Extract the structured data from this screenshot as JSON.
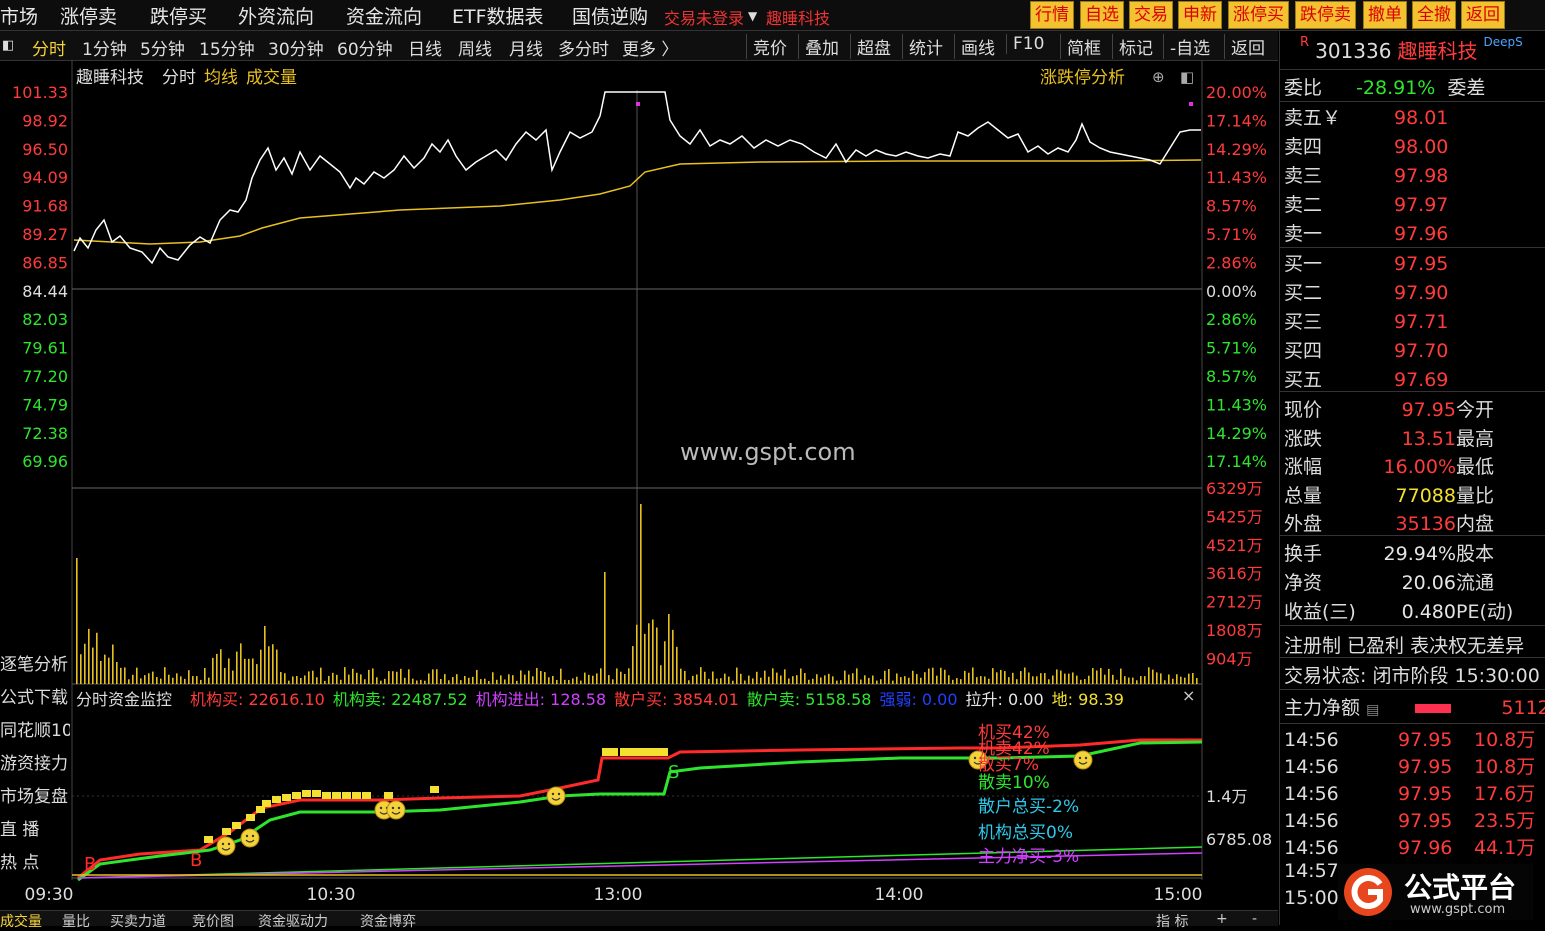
{
  "top_nav": {
    "items": [
      "市场",
      "涨停卖",
      "跌停买",
      "外资流向",
      "资金流向",
      "ETF数据表",
      "国债逆购"
    ],
    "login_warning": "交易未登录",
    "stock_name": "趣睡科技",
    "buttons": [
      "行情",
      "自选",
      "交易",
      "申新",
      "涨停买",
      "跌停卖",
      "撤单",
      "全撤",
      "返回"
    ]
  },
  "period_tabs": [
    "分时",
    "1分钟",
    "5分钟",
    "15分钟",
    "30分钟",
    "60分钟",
    "日线",
    "周线",
    "月线",
    "多分时",
    "更多 〉"
  ],
  "tools": [
    "竞价",
    "叠加",
    "超盘",
    "统计",
    "画线",
    "F10",
    "简框",
    "标记",
    "-自选",
    "返回"
  ],
  "chart_header": {
    "name": "趣睡科技",
    "mode": "分时",
    "avg_label": "均线",
    "vol_label": "成交量",
    "analysis": "涨跌停分析"
  },
  "watermark": "www.gspt.com",
  "price_axis": [
    "101.33",
    "98.92",
    "96.50",
    "94.09",
    "91.68",
    "89.27",
    "86.85",
    "84.44",
    "82.03",
    "79.61",
    "77.20",
    "74.79",
    "72.38",
    "69.96"
  ],
  "pct_axis": [
    "20.00%",
    "17.14%",
    "14.29%",
    "11.43%",
    "8.57%",
    "5.71%",
    "2.86%",
    "0.00%",
    "2.86%",
    "5.71%",
    "8.57%",
    "11.43%",
    "14.29%",
    "17.14%"
  ],
  "vol_axis": [
    "6329万",
    "5425万",
    "4521万",
    "3616万",
    "2712万",
    "1808万",
    "904万"
  ],
  "time_axis": [
    "09:30",
    "10:30",
    "13:00",
    "14:00",
    "15:00"
  ],
  "left_side": [
    "逐笔分析",
    "公式下载",
    "同花顺10",
    "游资接力",
    "市场复盘",
    "直 播",
    "热 点"
  ],
  "monitor": {
    "title": "分时资金监控",
    "items": [
      {
        "k": "机构买:",
        "v": "22616.10",
        "c": "#ff3b3b"
      },
      {
        "k": "机构卖:",
        "v": "22487.52",
        "c": "#2ee52e"
      },
      {
        "k": "机构进出:",
        "v": "128.58",
        "c": "#d040ff"
      },
      {
        "k": "散户买:",
        "v": "3854.01",
        "c": "#ff3b3b"
      },
      {
        "k": "散户卖:",
        "v": "5158.58",
        "c": "#2ee52e"
      },
      {
        "k": "强弱:",
        "v": "0.00",
        "c": "#2040ff"
      },
      {
        "k": "拉升:",
        "v": "0.00",
        "c": "#e6e6e6"
      },
      {
        "k": "地:",
        "v": "98.39",
        "c": "#f4e030"
      }
    ],
    "close": "×"
  },
  "monitor_axis": [
    "1.4万",
    "6785.08"
  ],
  "monitor_legend": [
    {
      "t": "机买42%",
      "c": "#ff3b3b"
    },
    {
      "t": "机卖42%",
      "c": "#ff3b3b"
    },
    {
      "t": "散买7%",
      "c": "#ff3b3b"
    },
    {
      "t": "散卖10%",
      "c": "#2ee52e"
    },
    {
      "t": "散户总买-2%",
      "c": "#2ec8e8"
    },
    {
      "t": "机构总买0%",
      "c": "#2ec8e8"
    },
    {
      "t": "主力净买-3%",
      "c": "#d040ff"
    }
  ],
  "signals": [
    "B",
    "B",
    "S"
  ],
  "quote": {
    "market_tag": "R",
    "code": "301336",
    "name": "趣睡科技",
    "tag": "DeepS",
    "weibi_label": "委比",
    "weibi": "-28.91%",
    "weicha_label": "委差",
    "asks": [
      {
        "l": "卖五￥",
        "p": "98.01"
      },
      {
        "l": "卖四",
        "p": "98.00"
      },
      {
        "l": "卖三",
        "p": "97.98"
      },
      {
        "l": "卖二",
        "p": "97.97"
      },
      {
        "l": "卖一",
        "p": "97.96"
      }
    ],
    "bids": [
      {
        "l": "买一",
        "p": "97.95"
      },
      {
        "l": "买二",
        "p": "97.90"
      },
      {
        "l": "买三",
        "p": "97.71"
      },
      {
        "l": "买四",
        "p": "97.70"
      },
      {
        "l": "买五",
        "p": "97.69"
      }
    ],
    "stats": [
      {
        "l": "现价",
        "v": "97.95",
        "c": "#ff3b3b",
        "r": "今开"
      },
      {
        "l": "涨跌",
        "v": "13.51",
        "c": "#ff3b3b",
        "r": "最高"
      },
      {
        "l": "涨幅",
        "v": "16.00%",
        "c": "#ff3b3b",
        "r": "最低"
      },
      {
        "l": "总量",
        "v": "77088",
        "c": "#f4e030",
        "r": "量比"
      },
      {
        "l": "外盘",
        "v": "35136",
        "c": "#ff3b3b",
        "r": "内盘"
      }
    ],
    "stats2": [
      {
        "l": "换手",
        "v": "29.94%",
        "r": "股本"
      },
      {
        "l": "净资",
        "v": "20.06",
        "r": "流通"
      },
      {
        "l": "收益(三)",
        "v": "0.480",
        "r": "PE(动)"
      }
    ],
    "reg": "注册制 已盈利 表决权无差异",
    "status": "交易状态: 闭市阶段 15:30:00",
    "main_net_label": "主力净额",
    "main_net_value": "5112",
    "ticks": [
      {
        "t": "14:56",
        "p": "97.95",
        "v": "10.8万"
      },
      {
        "t": "14:56",
        "p": "97.95",
        "v": "10.8万"
      },
      {
        "t": "14:56",
        "p": "97.95",
        "v": "17.6万"
      },
      {
        "t": "14:56",
        "p": "97.95",
        "v": "23.5万"
      },
      {
        "t": "14:56",
        "p": "97.96",
        "v": "44.1万"
      },
      {
        "t": "14:57",
        "p": "",
        "v": ""
      },
      {
        "t": "15:00",
        "p": "",
        "v": ""
      }
    ]
  },
  "logo": {
    "text": "公式平台",
    "sub": "www.gspt.com"
  },
  "bottom_tabs": [
    "成交量",
    "量比",
    "买卖力道",
    "竞价图",
    "资金驱动力",
    "资金博弈",
    "指 标",
    "+",
    "-"
  ],
  "colors": {
    "price_line": "#ffffff",
    "avg_line": "#e8c020",
    "volume": "#e8c020",
    "up": "#ff3b3b",
    "down": "#2ee52e",
    "grid": "#444444"
  }
}
